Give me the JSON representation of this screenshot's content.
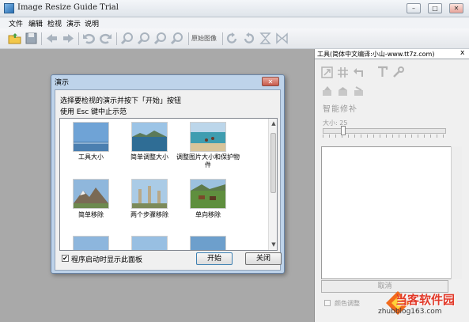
{
  "window": {
    "title": "Image Resize Guide Trial",
    "buttons": [
      "–",
      "□",
      "✕"
    ]
  },
  "menu": [
    "文件",
    "编辑",
    "检视",
    "演示",
    "说明"
  ],
  "toolbar": {
    "original_label": "原始图像"
  },
  "panel": {
    "title": "工具(简体中文编译:小山-www.tt7z.com)",
    "close": "x",
    "smart_label": "智能修补",
    "size_label": "大小: 25",
    "cancel_label": "取消",
    "color_label": "颜色调整"
  },
  "dialog": {
    "title": "演示",
    "close": "✕",
    "instruction1": "选择要检视的演示并按下「开始」按钮",
    "instruction2": "使用 Esc 键中止示范",
    "demos": [
      {
        "label": "工具大小",
        "scene": "blue-sky"
      },
      {
        "label": "简单调整大小",
        "scene": "lake"
      },
      {
        "label": "调整图片大小和保护物件",
        "scene": "beach"
      },
      {
        "label": "简单移除",
        "scene": "mountain"
      },
      {
        "label": "两个步骤移除",
        "scene": "ruins"
      },
      {
        "label": "单向移除",
        "scene": "horses"
      },
      {
        "label": "",
        "scene": "sky"
      },
      {
        "label": "",
        "scene": "sky"
      },
      {
        "label": "",
        "scene": "sea"
      }
    ],
    "startup_checkbox": "程序启动时显示此面板",
    "startup_checked": true,
    "start_button": "开始",
    "close_button": "关闭"
  },
  "watermark": {
    "name": "当客软件园",
    "url": "zhubblog163.com"
  }
}
